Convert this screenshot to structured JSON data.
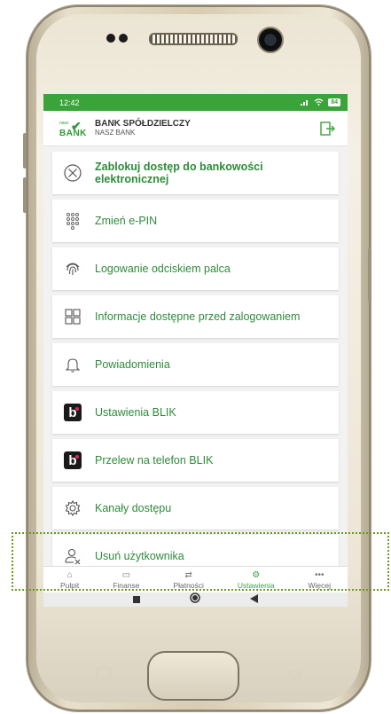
{
  "status": {
    "time": "12:42",
    "battery": "84"
  },
  "header": {
    "bank_name": "BANK SPÓŁDZIELCZY",
    "bank_sub": "NASZ BANK",
    "logo_small": "nasz",
    "logo_word": "BANK"
  },
  "menu": {
    "items": [
      {
        "label": "Zablokuj dostęp do bankowości elektronicznej",
        "icon": "block-circle-icon"
      },
      {
        "label": "Zmień e-PIN",
        "icon": "keypad-icon"
      },
      {
        "label": "Logowanie odciskiem palca",
        "icon": "fingerprint-icon"
      },
      {
        "label": "Informacje dostępne przed zalogowaniem",
        "icon": "grid-icon"
      },
      {
        "label": "Powiadomienia",
        "icon": "bell-icon"
      },
      {
        "label": "Ustawienia BLIK",
        "icon": "blik-icon"
      },
      {
        "label": "Przelew na telefon BLIK",
        "icon": "blik-icon"
      },
      {
        "label": "Kanały dostępu",
        "icon": "gear-icon"
      },
      {
        "label": "Usuń użytkownika",
        "icon": "remove-user-icon"
      }
    ]
  },
  "tabbar": {
    "tabs": [
      {
        "label": "Pulpit"
      },
      {
        "label": "Finanse"
      },
      {
        "label": "Płatności"
      },
      {
        "label": "Ustawienia"
      },
      {
        "label": "Więcej"
      }
    ],
    "active": "Ustawienia"
  },
  "colors": {
    "accent": "#3aa43a",
    "text_green": "#2e8b3a",
    "highlight": "#6b9a1e"
  }
}
